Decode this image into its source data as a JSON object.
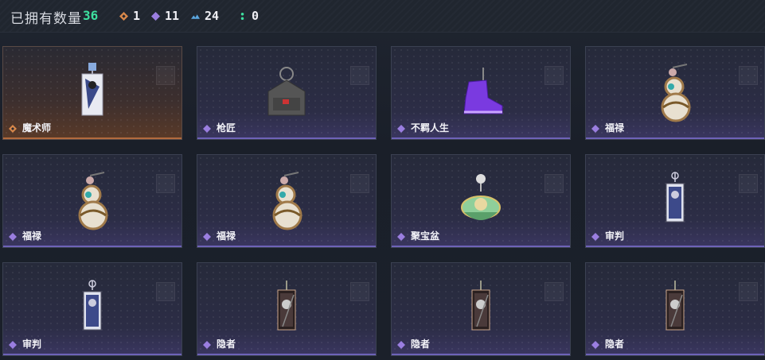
{
  "header": {
    "owned_label": "已拥有数量",
    "owned_count": "36",
    "stats": [
      {
        "icon": "orange-diamond-icon",
        "value": "1",
        "color": "#d9884a"
      },
      {
        "icon": "purple-diamond-icon",
        "value": "11",
        "color": "#9a7ee0"
      },
      {
        "icon": "blue-chevrons-icon",
        "value": "24",
        "color": "#5aa6e0"
      },
      {
        "icon": "green-dots-icon",
        "value": "0",
        "color": "#3ee0a0"
      }
    ]
  },
  "items": [
    {
      "name": "魔术师",
      "rarity": "orange",
      "art": "magician-card-pendant"
    },
    {
      "name": "枪匠",
      "rarity": "purple",
      "art": "gunsmith-bag-pendant"
    },
    {
      "name": "不羁人生",
      "rarity": "purple",
      "art": "sneaker-pendant"
    },
    {
      "name": "福禄",
      "rarity": "purple",
      "art": "gourd-pendant"
    },
    {
      "name": "福禄",
      "rarity": "purple",
      "art": "gourd-pendant"
    },
    {
      "name": "福禄",
      "rarity": "purple",
      "art": "gourd-pendant"
    },
    {
      "name": "聚宝盆",
      "rarity": "purple",
      "art": "treasure-bowl-pendant"
    },
    {
      "name": "审判",
      "rarity": "purple",
      "art": "judgment-card-pendant"
    },
    {
      "name": "审判",
      "rarity": "purple",
      "art": "judgment-card-pendant"
    },
    {
      "name": "隐者",
      "rarity": "purple",
      "art": "hermit-card-pendant"
    },
    {
      "name": "隐者",
      "rarity": "purple",
      "art": "hermit-card-pendant"
    },
    {
      "name": "隐者",
      "rarity": "purple",
      "art": "hermit-card-pendant"
    }
  ]
}
